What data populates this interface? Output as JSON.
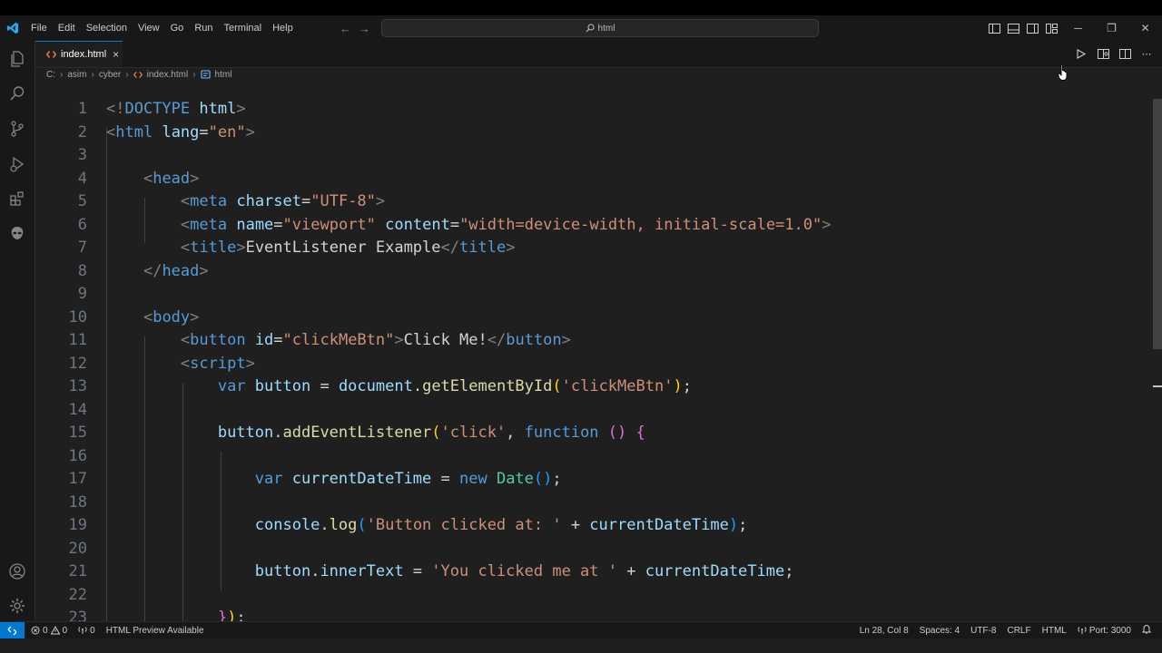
{
  "menu": [
    "File",
    "Edit",
    "Selection",
    "View",
    "Go",
    "Run",
    "Terminal",
    "Help"
  ],
  "search": {
    "text": "html"
  },
  "tab": {
    "label": "index.html",
    "close": "×"
  },
  "breadcrumb": [
    "C:",
    "asim",
    "cyber",
    "index.html",
    "html"
  ],
  "code_lines": [
    {
      "n": "1",
      "tokens": [
        [
          "t-punct",
          "<!"
        ],
        [
          "t-tag",
          "DOCTYPE"
        ],
        [
          "t-text",
          " "
        ],
        [
          "t-attr",
          "html"
        ],
        [
          "t-punct",
          ">"
        ]
      ]
    },
    {
      "n": "2",
      "tokens": [
        [
          "t-punct",
          "<"
        ],
        [
          "t-tag",
          "html"
        ],
        [
          "t-text",
          " "
        ],
        [
          "t-attr",
          "lang"
        ],
        [
          "t-text",
          "="
        ],
        [
          "t-str",
          "\"en\""
        ],
        [
          "t-punct",
          ">"
        ]
      ]
    },
    {
      "n": "3",
      "tokens": []
    },
    {
      "n": "4",
      "tokens": [
        [
          "t-text",
          "    "
        ],
        [
          "t-punct",
          "<"
        ],
        [
          "t-tag",
          "head"
        ],
        [
          "t-punct",
          ">"
        ]
      ]
    },
    {
      "n": "5",
      "tokens": [
        [
          "t-text",
          "        "
        ],
        [
          "t-punct",
          "<"
        ],
        [
          "t-tag",
          "meta"
        ],
        [
          "t-text",
          " "
        ],
        [
          "t-attr",
          "charset"
        ],
        [
          "t-text",
          "="
        ],
        [
          "t-str",
          "\"UTF-8\""
        ],
        [
          "t-punct",
          ">"
        ]
      ]
    },
    {
      "n": "6",
      "tokens": [
        [
          "t-text",
          "        "
        ],
        [
          "t-punct",
          "<"
        ],
        [
          "t-tag",
          "meta"
        ],
        [
          "t-text",
          " "
        ],
        [
          "t-attr",
          "name"
        ],
        [
          "t-text",
          "="
        ],
        [
          "t-str",
          "\"viewport\""
        ],
        [
          "t-text",
          " "
        ],
        [
          "t-attr",
          "content"
        ],
        [
          "t-text",
          "="
        ],
        [
          "t-str",
          "\"width=device-width, initial-scale=1.0\""
        ],
        [
          "t-punct",
          ">"
        ]
      ]
    },
    {
      "n": "7",
      "tokens": [
        [
          "t-text",
          "        "
        ],
        [
          "t-punct",
          "<"
        ],
        [
          "t-tag",
          "title"
        ],
        [
          "t-punct",
          ">"
        ],
        [
          "t-text",
          "EventListener Example"
        ],
        [
          "t-punct",
          "</"
        ],
        [
          "t-tag",
          "title"
        ],
        [
          "t-punct",
          ">"
        ]
      ]
    },
    {
      "n": "8",
      "tokens": [
        [
          "t-text",
          "    "
        ],
        [
          "t-punct",
          "</"
        ],
        [
          "t-tag",
          "head"
        ],
        [
          "t-punct",
          ">"
        ]
      ]
    },
    {
      "n": "9",
      "tokens": []
    },
    {
      "n": "10",
      "tokens": [
        [
          "t-text",
          "    "
        ],
        [
          "t-punct",
          "<"
        ],
        [
          "t-tag",
          "body"
        ],
        [
          "t-punct",
          ">"
        ]
      ]
    },
    {
      "n": "11",
      "tokens": [
        [
          "t-text",
          "        "
        ],
        [
          "t-punct",
          "<"
        ],
        [
          "t-tag",
          "button"
        ],
        [
          "t-text",
          " "
        ],
        [
          "t-attr",
          "id"
        ],
        [
          "t-text",
          "="
        ],
        [
          "t-str",
          "\"clickMeBtn\""
        ],
        [
          "t-punct",
          ">"
        ],
        [
          "t-text",
          "Click Me!"
        ],
        [
          "t-punct",
          "</"
        ],
        [
          "t-tag",
          "button"
        ],
        [
          "t-punct",
          ">"
        ]
      ]
    },
    {
      "n": "12",
      "tokens": [
        [
          "t-text",
          "        "
        ],
        [
          "t-punct",
          "<"
        ],
        [
          "t-tag",
          "script"
        ],
        [
          "t-punct",
          ">"
        ]
      ]
    },
    {
      "n": "13",
      "tokens": [
        [
          "t-text",
          "            "
        ],
        [
          "t-kw",
          "var"
        ],
        [
          "t-text",
          " "
        ],
        [
          "t-var",
          "button"
        ],
        [
          "t-text",
          " = "
        ],
        [
          "t-var",
          "document"
        ],
        [
          "t-text",
          "."
        ],
        [
          "t-fn",
          "getElementById"
        ],
        [
          "t-b1",
          "("
        ],
        [
          "t-str",
          "'clickMeBtn'"
        ],
        [
          "t-b1",
          ")"
        ],
        [
          "t-text",
          ";"
        ]
      ]
    },
    {
      "n": "14",
      "tokens": []
    },
    {
      "n": "15",
      "tokens": [
        [
          "t-text",
          "            "
        ],
        [
          "t-var",
          "button"
        ],
        [
          "t-text",
          "."
        ],
        [
          "t-fn",
          "addEventListener"
        ],
        [
          "t-b1",
          "("
        ],
        [
          "t-str",
          "'click'"
        ],
        [
          "t-text",
          ", "
        ],
        [
          "t-kw",
          "function"
        ],
        [
          "t-text",
          " "
        ],
        [
          "t-b2",
          "()"
        ],
        [
          "t-text",
          " "
        ],
        [
          "t-b2",
          "{"
        ]
      ]
    },
    {
      "n": "16",
      "tokens": []
    },
    {
      "n": "17",
      "tokens": [
        [
          "t-text",
          "                "
        ],
        [
          "t-kw",
          "var"
        ],
        [
          "t-text",
          " "
        ],
        [
          "t-var",
          "currentDateTime"
        ],
        [
          "t-text",
          " = "
        ],
        [
          "t-kw",
          "new"
        ],
        [
          "t-text",
          " "
        ],
        [
          "t-cls",
          "Date"
        ],
        [
          "t-b3",
          "()"
        ],
        [
          "t-text",
          ";"
        ]
      ]
    },
    {
      "n": "18",
      "tokens": []
    },
    {
      "n": "19",
      "tokens": [
        [
          "t-text",
          "                "
        ],
        [
          "t-var",
          "console"
        ],
        [
          "t-text",
          "."
        ],
        [
          "t-fn",
          "log"
        ],
        [
          "t-b3",
          "("
        ],
        [
          "t-str",
          "'Button clicked at: '"
        ],
        [
          "t-text",
          " + "
        ],
        [
          "t-var",
          "currentDateTime"
        ],
        [
          "t-b3",
          ")"
        ],
        [
          "t-text",
          ";"
        ]
      ]
    },
    {
      "n": "20",
      "tokens": []
    },
    {
      "n": "21",
      "tokens": [
        [
          "t-text",
          "                "
        ],
        [
          "t-var",
          "button"
        ],
        [
          "t-text",
          "."
        ],
        [
          "t-var",
          "innerText"
        ],
        [
          "t-text",
          " = "
        ],
        [
          "t-str",
          "'You clicked me at '"
        ],
        [
          "t-text",
          " + "
        ],
        [
          "t-var",
          "currentDateTime"
        ],
        [
          "t-text",
          ";"
        ]
      ]
    },
    {
      "n": "22",
      "tokens": []
    },
    {
      "n": "23",
      "tokens": [
        [
          "t-text",
          "            "
        ],
        [
          "t-b2",
          "}"
        ],
        [
          "t-b1",
          ")"
        ],
        [
          "t-text",
          ";"
        ]
      ]
    }
  ],
  "status": {
    "errors": "0",
    "warnings": "0",
    "ports": "0",
    "preview": "HTML Preview Available",
    "position": "Ln 28, Col 8",
    "spaces": "Spaces: 4",
    "encoding": "UTF-8",
    "eol": "CRLF",
    "language": "HTML",
    "port": "Port: 3000"
  },
  "colors": {
    "accent": "#0078d4",
    "background": "#1f1f1f",
    "chrome": "#181818"
  }
}
